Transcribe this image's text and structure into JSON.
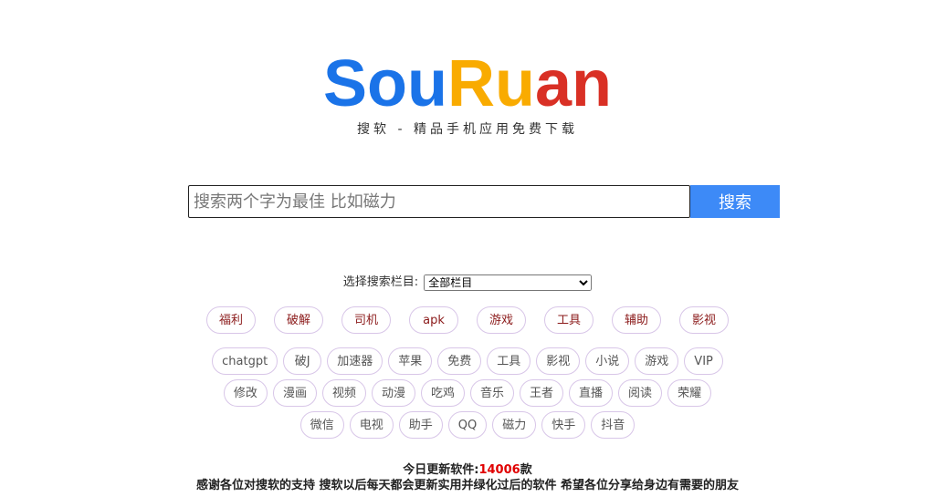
{
  "logo": {
    "part1": "Sou",
    "part2": "Ru",
    "part3": "an"
  },
  "tagline": "搜软 - 精品手机应用免费下载",
  "search": {
    "placeholder": "搜索两个字为最佳 比如磁力",
    "value": "",
    "button_label": "搜索"
  },
  "category": {
    "label": "选择搜索栏目:",
    "selected": "全部栏目"
  },
  "primary_tags": [
    "福利",
    "破解",
    "司机",
    "apk",
    "游戏",
    "工具",
    "辅助",
    "影视"
  ],
  "secondary_tags_row1": [
    "chatgpt",
    "破J",
    "加速器",
    "苹果",
    "免费",
    "工具",
    "影视",
    "小说",
    "游戏",
    "VIP"
  ],
  "secondary_tags_row2": [
    "修改",
    "漫画",
    "视频",
    "动漫",
    "吃鸡",
    "音乐",
    "王者",
    "直播",
    "阅读",
    "荣耀"
  ],
  "secondary_tags_row3": [
    "微信",
    "电视",
    "助手",
    "QQ",
    "磁力",
    "快手",
    "抖音"
  ],
  "footer": {
    "update_label": "今日更新软件:",
    "update_count": "14006",
    "update_unit": "款",
    "thanks": "感谢各位对搜软的支持 搜软以后每天都会更新实用并绿化过后的软件 希望各位分享给身边有需要的朋友"
  },
  "colors": {
    "logo_blue": "#1a73e8",
    "logo_yellow": "#f9ab00",
    "logo_red": "#d93025",
    "button_blue": "#3d8af7",
    "count_red": "#e00000"
  }
}
